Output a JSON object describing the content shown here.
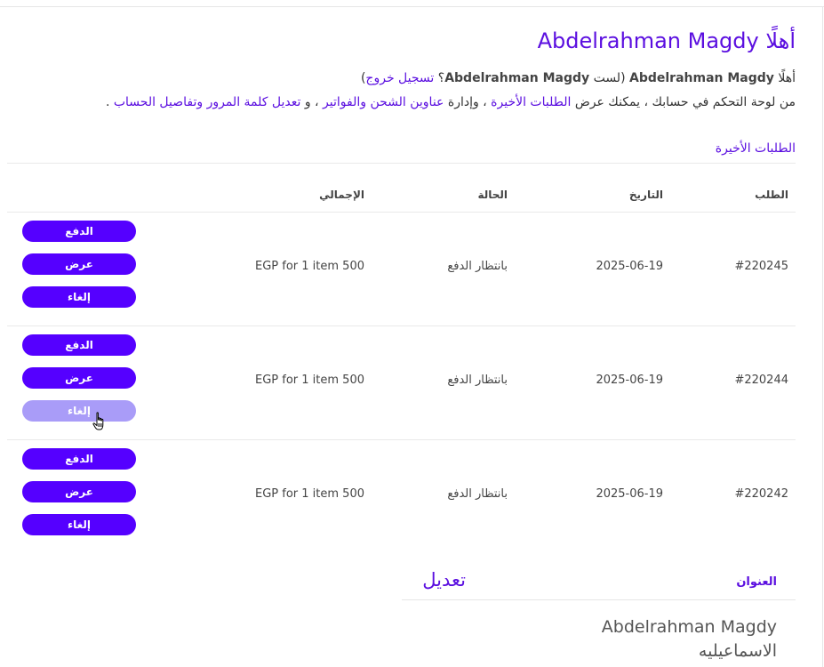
{
  "account": {
    "title": "أهلًا Abdelrahman Magdy",
    "hello_prefix": "أهلًا ",
    "user_name": "Abdelrahman Magdy",
    "not_prefix": " (لست ",
    "user_name_2": "Abdelrahman Magdy",
    "not_suffix": "؟ ",
    "logout_link": "تسجيل خروج",
    "close_paren": ")",
    "desc_1": "من لوحة التحكم في حسابك ، يمكنك عرض ",
    "recent_orders_link": "الطلبات الأخيرة",
    "desc_2": " ، وإدارة ",
    "addresses_link": "عناوين الشحن والفواتير",
    "desc_3": " ، و ",
    "edit_account_link": "تعديل كلمة المرور وتفاصيل الحساب",
    "desc_4": " ."
  },
  "orders": {
    "heading": "الطلبات الأخيرة",
    "columns": {
      "order": "الطلب",
      "date": "التاريخ",
      "status": "الحالة",
      "total": "الإجمالي"
    },
    "rows": [
      {
        "number": "#220245",
        "date": "2025-06-19",
        "status": "بانتظار الدفع",
        "total": "EGP for 1 item 500",
        "pay": "الدفع",
        "view": "عرض",
        "cancel": "إلغاء"
      },
      {
        "number": "#220244",
        "date": "2025-06-19",
        "status": "بانتظار الدفع",
        "total": "EGP for 1 item 500",
        "pay": "الدفع",
        "view": "عرض",
        "cancel": "إلغاء"
      },
      {
        "number": "#220242",
        "date": "2025-06-19",
        "status": "بانتظار الدفع",
        "total": "EGP for 1 item 500",
        "pay": "الدفع",
        "view": "عرض",
        "cancel": "إلغاء"
      }
    ]
  },
  "address": {
    "label": "العنوان",
    "edit": "تعديل",
    "name": "Abdelrahman Magdy",
    "city": "الاسماعيليه"
  },
  "colors": {
    "accent": "#5b0fe0",
    "button": "#5500ff",
    "button_hover": "#a99cf8"
  }
}
